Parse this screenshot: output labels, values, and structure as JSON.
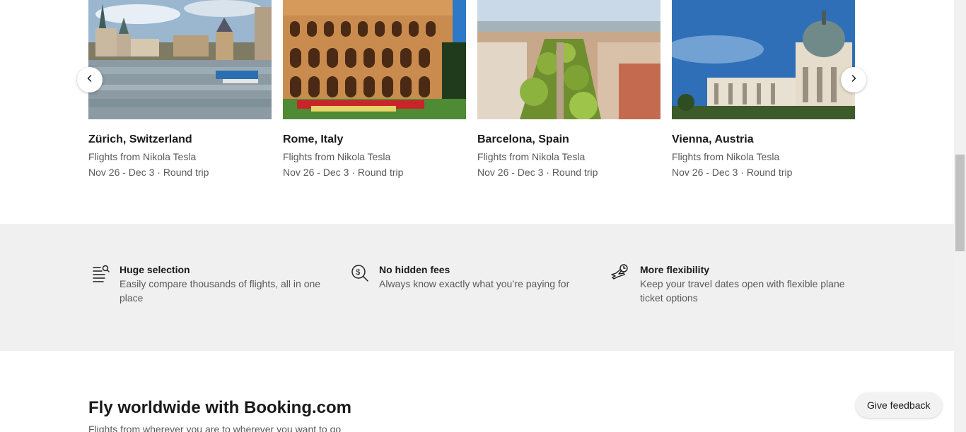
{
  "destinations": [
    {
      "city": "Zürich, Switzerland",
      "from": "Flights from Nikola Tesla",
      "dates": "Nov 26 - Dec 3 · Round trip"
    },
    {
      "city": "Rome, Italy",
      "from": "Flights from Nikola Tesla",
      "dates": "Nov 26 - Dec 3 · Round trip"
    },
    {
      "city": "Barcelona, Spain",
      "from": "Flights from Nikola Tesla",
      "dates": "Nov 26 - Dec 3 · Round trip"
    },
    {
      "city": "Vienna, Austria",
      "from": "Flights from Nikola Tesla",
      "dates": "Nov 26 - Dec 3 · Round trip"
    }
  ],
  "carousel": {
    "prev_icon": "chevron-left-icon",
    "next_icon": "chevron-right-icon"
  },
  "features": [
    {
      "icon": "list-search-icon",
      "title": "Huge selection",
      "desc": "Easily compare thousands of flights, all in one place"
    },
    {
      "icon": "magnifier-dollar-icon",
      "title": "No hidden fees",
      "desc": "Always know exactly what you’re paying for"
    },
    {
      "icon": "plane-clock-icon",
      "title": "More flexibility",
      "desc": "Keep your travel dates open with flexible plane ticket options"
    }
  ],
  "section": {
    "title": "Fly worldwide with Booking.com",
    "subtitle": "Flights from wherever you are to wherever you want to go"
  },
  "feedback": {
    "label": "Give feedback"
  },
  "colors": {
    "features_bg": "#f0f0f0",
    "text": "#1a1a1a",
    "muted": "#595959"
  }
}
